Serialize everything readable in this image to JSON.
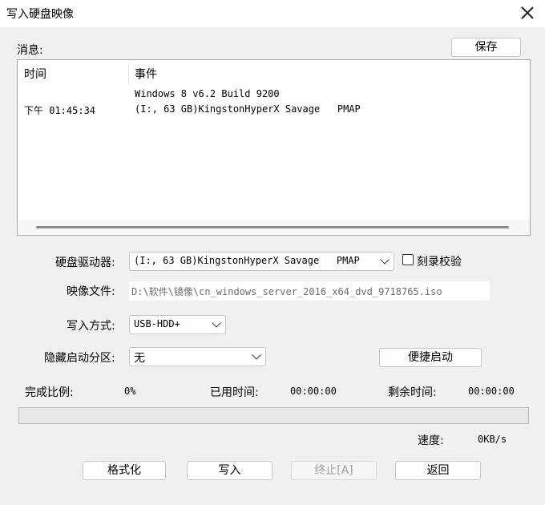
{
  "window": {
    "title": "写入硬盘映像"
  },
  "messages": {
    "label": "消息:",
    "save_label": "保存",
    "columns": [
      "时间",
      "事件"
    ],
    "rows": [
      {
        "time": "",
        "event": "Windows 8 v6.2 Build 9200"
      },
      {
        "time": "下午 01:45:34",
        "event": "(I:, 63 GB)KingstonHyperX Savage   PMAP"
      }
    ]
  },
  "form": {
    "drive_label": "硬盘驱动器:",
    "drive_value": "(I:, 63 GB)KingstonHyperX Savage   PMAP",
    "verify_label": "刻录校验",
    "verify_checked": false,
    "image_label": "映像文件:",
    "image_value": "D:\\软件\\镜像\\cn_windows_server_2016_x64_dvd_9718765.iso",
    "method_label": "写入方式:",
    "method_value": "USB-HDD+",
    "hidden_label": "隐藏启动分区:",
    "hidden_value": "无",
    "quick_boot_label": "便捷启动"
  },
  "status": {
    "ratio_label": "完成比例:",
    "ratio_value": "0%",
    "progress": 0,
    "elapsed_label": "已用时间:",
    "elapsed_value": "00:00:00",
    "remaining_label": "剩余时间:",
    "remaining_value": "00:00:00",
    "speed_label": "速度:",
    "speed_value": "0KB/s"
  },
  "actions": {
    "format_label": "格式化",
    "write_label": "写入",
    "stop_label": "终止[A]",
    "back_label": "返回"
  },
  "colors": {
    "progress_fill": "#06b025"
  }
}
